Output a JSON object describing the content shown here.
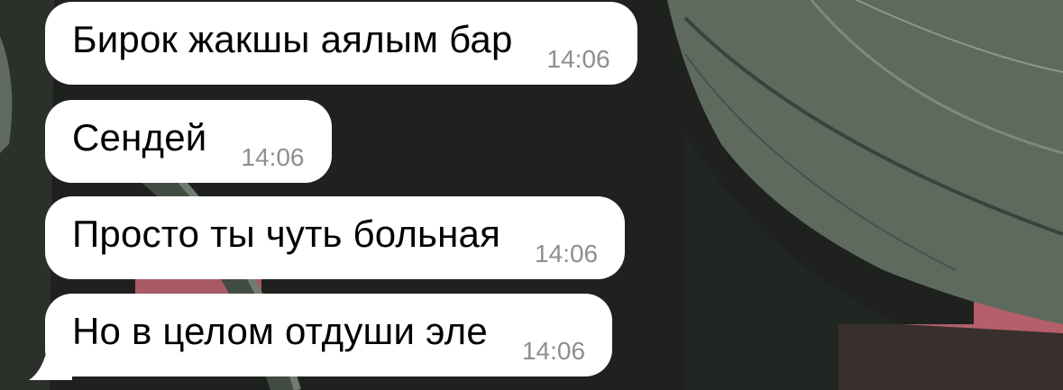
{
  "messages": [
    {
      "text": "Бирок жакшы аялым бар",
      "time": "14:06"
    },
    {
      "text": "Сендей",
      "time": "14:06"
    },
    {
      "text": "Просто ты чуть больная",
      "time": "14:06"
    },
    {
      "text": "Но в целом отдуши эле",
      "time": "14:06"
    }
  ]
}
